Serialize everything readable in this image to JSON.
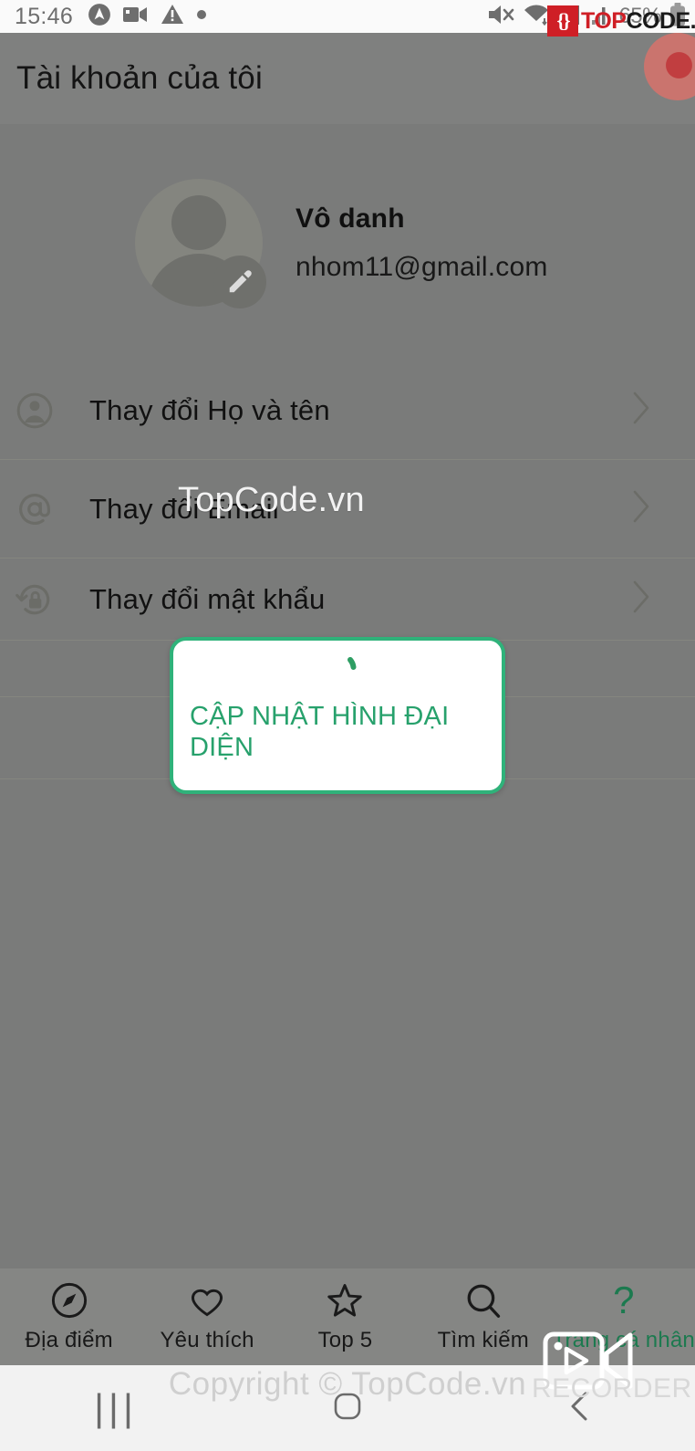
{
  "status_bar": {
    "time": "15:46",
    "battery_percent": "65%",
    "left_icons": [
      "vpn-icon",
      "screen-recorder-icon",
      "warning-icon",
      "dot-icon"
    ],
    "right_icons": [
      "mute-icon",
      "wifi-icon",
      "signal-icon",
      "signal-secondary-icon",
      "battery-icon"
    ]
  },
  "brand_overlay": {
    "mark": "{}",
    "name_red": "TOP",
    "name_dark": "CODE.VN"
  },
  "appbar": {
    "title": "Tài khoản của tôi"
  },
  "profile": {
    "name": "Vô danh",
    "email": "nhom11@gmail.com",
    "avatar_icon": "user-avatar-icon",
    "edit_icon": "pencil-edit-icon"
  },
  "settings_rows": [
    {
      "label": "Thay đổi Họ và tên",
      "icon": "account-circle-icon"
    },
    {
      "label": "Thay đổi Email",
      "icon": "at-sign-icon"
    },
    {
      "label": "Thay đổi mật khẩu",
      "icon": "lock-reset-icon"
    }
  ],
  "dialog": {
    "message": "CẬP NHẬT HÌNH ĐẠI DIỆN",
    "spinner_icon": "loading-spinner-icon",
    "border_color": "#2fb27a",
    "text_color": "#27a16c"
  },
  "watermarks": {
    "center": "TopCode.vn",
    "copyright": "Copyright © TopCode.vn",
    "recorder_label": "RECORDER",
    "recorder_icon": "video-camera-icon"
  },
  "bottom_nav": {
    "items": [
      {
        "label": "Địa điểm",
        "icon": "compass-icon",
        "active": false
      },
      {
        "label": "Yêu thích",
        "icon": "heart-icon",
        "active": false
      },
      {
        "label": "Top 5",
        "icon": "star-icon",
        "active": false
      },
      {
        "label": "Tìm kiếm",
        "icon": "search-icon",
        "active": false
      },
      {
        "label": "Trang cá nhân",
        "icon": "question-mark-icon",
        "active": true
      }
    ],
    "active_color": "#1c7a4f"
  },
  "system_nav": {
    "recents": "|||",
    "home_icon": "home-square-icon",
    "back_icon": "back-chevron-icon"
  }
}
